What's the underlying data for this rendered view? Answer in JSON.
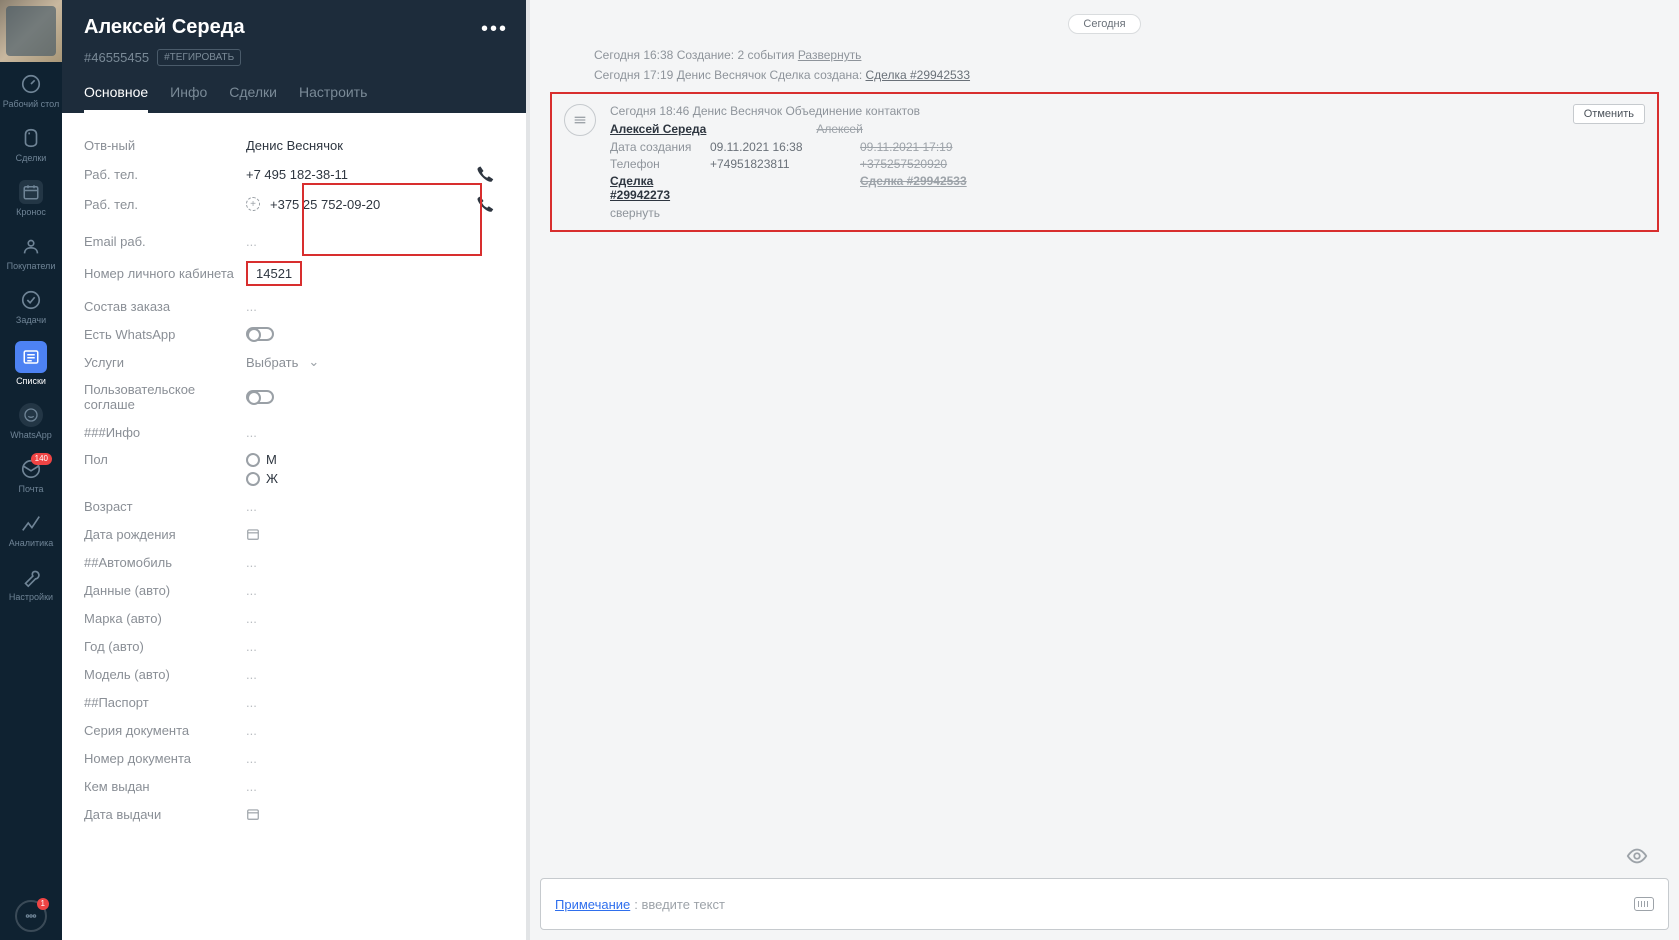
{
  "sidebar": {
    "items": [
      {
        "label": "Рабочий стол",
        "name": "nav-desktop"
      },
      {
        "label": "Сделки",
        "name": "nav-deals"
      },
      {
        "label": "Кронос",
        "name": "nav-kronos"
      },
      {
        "label": "Покупатели",
        "name": "nav-customers"
      },
      {
        "label": "Задачи",
        "name": "nav-tasks"
      },
      {
        "label": "Списки",
        "name": "nav-lists",
        "active": true
      },
      {
        "label": "WhatsApp",
        "name": "nav-whatsapp"
      },
      {
        "label": "Почта",
        "name": "nav-mail",
        "badge": "140"
      },
      {
        "label": "Аналитика",
        "name": "nav-analytics"
      },
      {
        "label": "Настройки",
        "name": "nav-settings"
      }
    ],
    "notif_badge": "1"
  },
  "contact": {
    "title": "Алексей Середа",
    "id": "#46555455",
    "tag_button": "#ТЕГИРОВАТЬ",
    "tabs": {
      "main": "Основное",
      "info": "Инфо",
      "deals": "Сделки",
      "configure": "Настроить"
    },
    "fields": {
      "responsible_label": "Отв-ный",
      "responsible_value": "Денис Веснячок",
      "phone1_label": "Раб. тел.",
      "phone1_value": "+7 495 182-38-11",
      "phone2_label": "Раб. тел.",
      "phone2_value": "+375 25 752-09-20",
      "email_label": "Email раб.",
      "account_label": "Номер личного кабинета",
      "account_value": "14521",
      "order_label": "Состав заказа",
      "whatsapp_label": "Есть WhatsApp",
      "services_label": "Услуги",
      "services_value": "Выбрать",
      "agreement_label": "Пользовательское соглаше",
      "infoheader_label": "###Инфо",
      "gender_label": "Пол",
      "gender_m": "М",
      "gender_f": "Ж",
      "age_label": "Возраст",
      "birth_label": "Дата рождения",
      "carheader_label": "##Автомобиль",
      "cardata_label": "Данные (авто)",
      "brand_label": "Марка (авто)",
      "year_label": "Год (авто)",
      "model_label": "Модель (авто)",
      "passportheader_label": "##Паспорт",
      "docseries_label": "Серия документа",
      "docnum_label": "Номер документа",
      "issuedby_label": "Кем выдан",
      "issuedate_label": "Дата выдачи",
      "dots": "..."
    }
  },
  "feed": {
    "today": "Сегодня",
    "line1_time": "Сегодня 16:38 Создание: 2 события ",
    "line1_link": "Развернуть",
    "line2_prefix": "Сегодня 17:19 Денис Веснячок Сделка создана: ",
    "line2_link": "Сделка #29942533",
    "merge": {
      "headline": "Сегодня 18:46 Денис Веснячок Объединение контактов",
      "name_primary": "Алексей Середа",
      "name_secondary": "Алексей",
      "created_label": "Дата создания",
      "created_v1": "09.11.2021 16:38",
      "created_v2": "09.11.2021 17:19",
      "phone_label": "Телефон",
      "phone_v1": "+74951823811",
      "phone_v2": "+375257520920",
      "deal_v1": "Сделка #29942273",
      "deal_v2": "Сделка #29942533",
      "collapse": "свернуть",
      "cancel": "Отменить"
    }
  },
  "note": {
    "prefix": "Примечание",
    "placeholder": ": введите текст"
  }
}
